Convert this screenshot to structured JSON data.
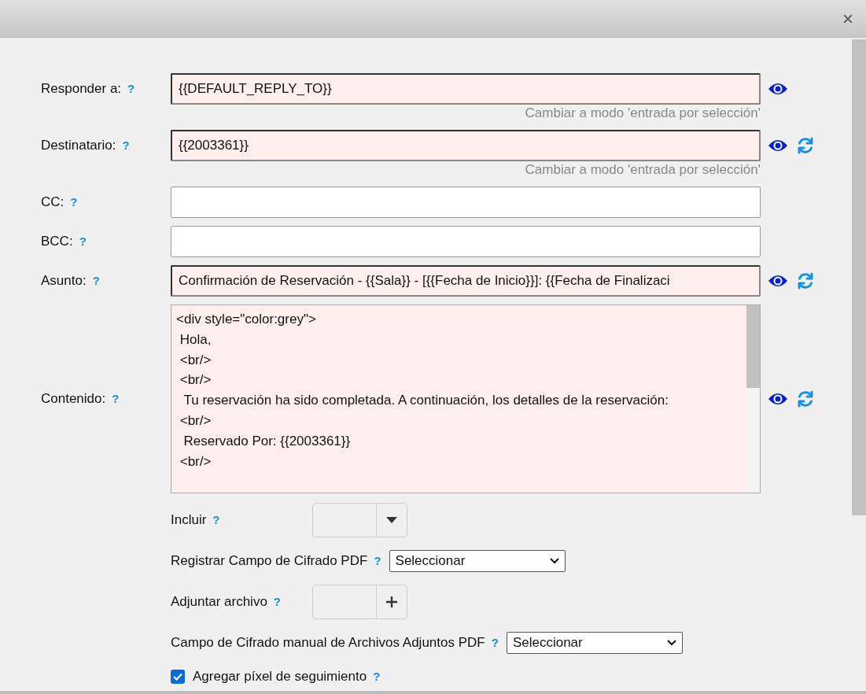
{
  "dialog": {
    "close_label": "×"
  },
  "fields": [
    {
      "kind": "input",
      "label": "Responder a:",
      "help": "?",
      "value": "{{DEFAULT_REPLY_TO}}",
      "highlighted": true,
      "hint": "Cambiar a modo 'entrada por selección'",
      "preview": true,
      "refresh": false
    },
    {
      "kind": "input",
      "label": "Destinatario:",
      "help": "?",
      "value": "{{2003361}}",
      "highlighted": true,
      "hint": "Cambiar a modo 'entrada por selección'",
      "preview": true,
      "refresh": true
    },
    {
      "kind": "input",
      "label": "CC:",
      "help": "?",
      "highlighted": false,
      "preview": false,
      "refresh": false
    },
    {
      "kind": "input",
      "label": "BCC:",
      "help": "?",
      "highlighted": false,
      "preview": false,
      "refresh": false
    },
    {
      "kind": "input",
      "label": "Asunto:",
      "help": "?",
      "value": "Confirmación de Reservación - {{Sala}} - [{{Fecha de Inicio}}]: {{Fecha de Finalizaci",
      "highlighted": true,
      "preview": true,
      "refresh": true
    },
    {
      "kind": "textarea",
      "label": "Contenido:",
      "help": "?",
      "value": "<div style=\"color:grey\">\n Hola,\n <br/>\n <br/>\n  Tu reservación ha sido completada. A continuación, los detalles de la reservación:\n <br/>\n  Reservado Por: {{2003361}}\n <br/>",
      "highlighted": true,
      "preview": true,
      "refresh": true
    }
  ],
  "options": [
    {
      "kind": "dropdown-group",
      "label": "Incluir",
      "help": "?"
    },
    {
      "kind": "select",
      "label": "Registrar Campo de Cifrado PDF",
      "help": "?",
      "value": "Seleccionar"
    },
    {
      "kind": "add-group",
      "label": "Adjuntar archivo",
      "help": "?"
    },
    {
      "kind": "select",
      "label": "Campo de Cifrado manual de Archivos Adjuntos PDF",
      "help": "?",
      "value": "Seleccionar"
    },
    {
      "kind": "checkbox",
      "label": "Agregar píxel de seguimiento",
      "help": "?",
      "checked": true
    }
  ]
}
